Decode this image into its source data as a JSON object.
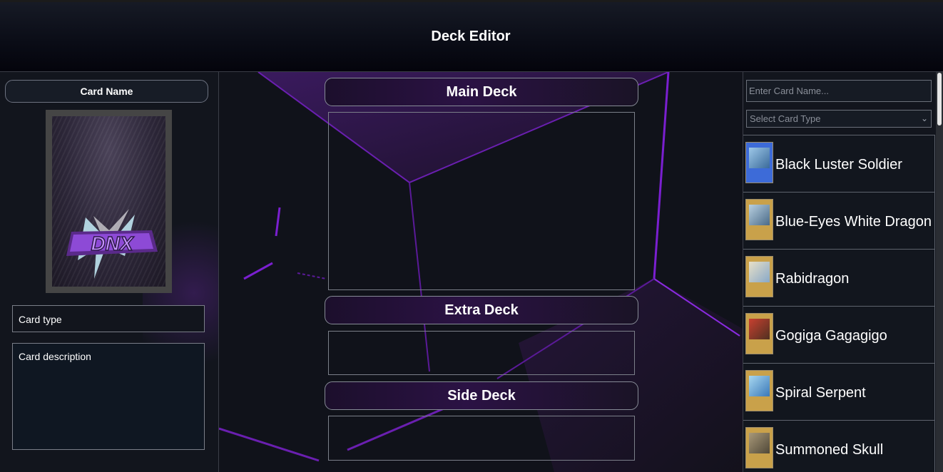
{
  "header": {
    "title": "Deck Editor"
  },
  "card_detail": {
    "name_label": "Card Name",
    "type_label": "Card type",
    "description_label": "Card description",
    "card_back_logo_text": "DNX"
  },
  "decks": {
    "main": {
      "label": "Main Deck"
    },
    "extra": {
      "label": "Extra Deck"
    },
    "side": {
      "label": "Side Deck"
    }
  },
  "search": {
    "name_placeholder": "Enter Card Name...",
    "type_placeholder": "Select Card Type"
  },
  "card_list": [
    {
      "name": "Black Luster Soldier",
      "frame": "ritual"
    },
    {
      "name": "Blue-Eyes White Dragon",
      "frame": "normal"
    },
    {
      "name": "Rabidragon",
      "frame": "normal"
    },
    {
      "name": "Gogiga Gagagigo",
      "frame": "normal"
    },
    {
      "name": "Spiral Serpent",
      "frame": "normal"
    },
    {
      "name": "Summoned Skull",
      "frame": "normal"
    }
  ],
  "colors": {
    "accent_purple": "#7a1fd0",
    "ritual_frame": "#3d6bd8",
    "normal_frame": "#c9a14a"
  }
}
